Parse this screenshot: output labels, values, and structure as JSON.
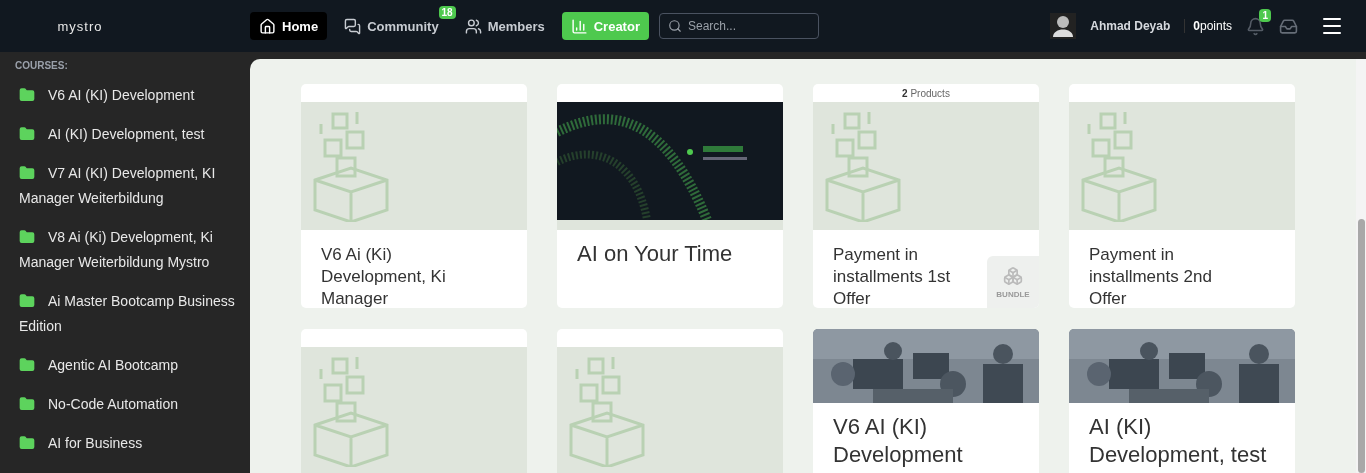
{
  "header": {
    "logo": "mystro",
    "nav": [
      {
        "label": "Home",
        "selected": true
      },
      {
        "label": "Community",
        "selected": false,
        "badge": "18"
      },
      {
        "label": "Members",
        "selected": false
      },
      {
        "label": "Creator",
        "selected": false,
        "kind": "creator"
      }
    ],
    "search": {
      "placeholder": "Search..."
    },
    "user": {
      "name": "Ahmad Deyab",
      "points_value": "0",
      "points_label": "points"
    },
    "notifications_badge": "1"
  },
  "sidebar": {
    "heading": "COURSES:",
    "items": [
      "V6 AI (KI) Development",
      "AI (KI) Development, test",
      "V7 AI (KI) Development, KI Manager Weiterbildung",
      "V8 Ai (Ki) Development, Ki Manager Weiterbildung Mystro",
      "Ai Master Bootcamp Business Edition",
      "Agentic AI Bootcamp",
      "No-Code Automation",
      "AI for Business"
    ]
  },
  "cards": [
    {
      "kind": "placeholder",
      "title": "V6 Ai (Ki) Development, Ki Manager"
    },
    {
      "kind": "banner",
      "title": "AI on Your Time"
    },
    {
      "kind": "placeholder",
      "products_count": "2",
      "products_label": "Products",
      "title": "Payment in installments 1st Offer",
      "bundle": "BUNDLE"
    },
    {
      "kind": "placeholder",
      "title": "Payment in installments 2nd Offer"
    },
    {
      "kind": "placeholder"
    },
    {
      "kind": "placeholder"
    },
    {
      "title": "V6 AI (KI) Development"
    },
    {
      "title": "AI (KI) Development, test"
    }
  ]
}
